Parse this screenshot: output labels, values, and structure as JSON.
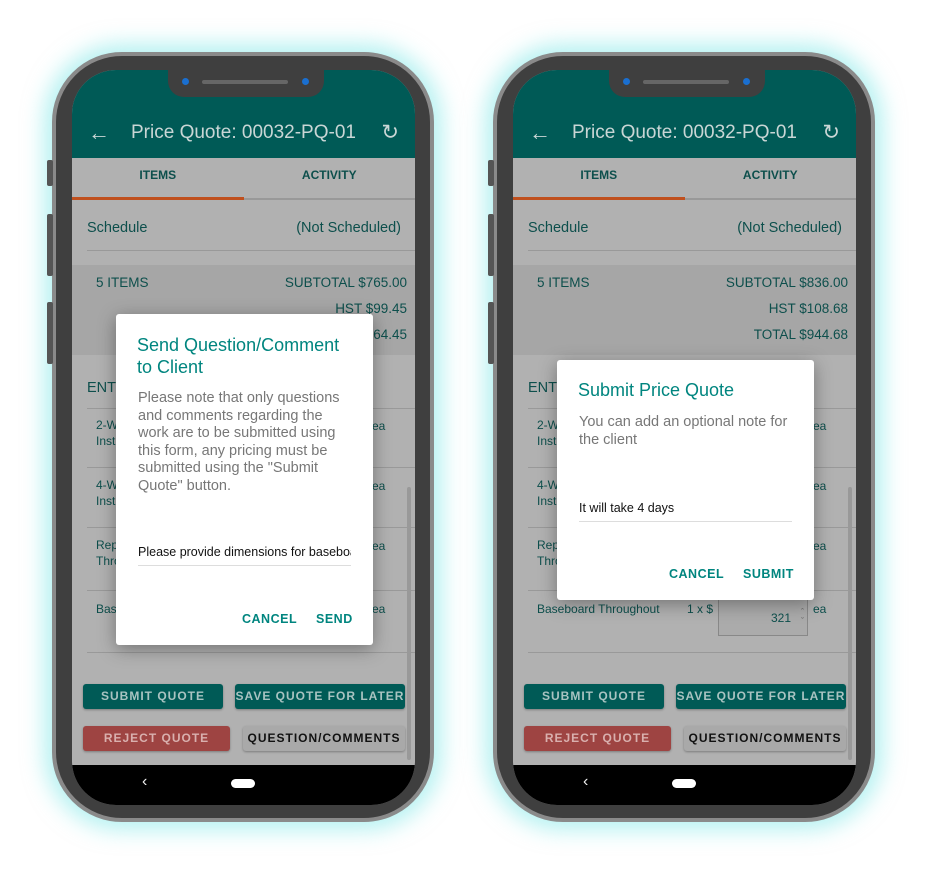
{
  "colors": {
    "header": "#005a56",
    "accent": "#00857f",
    "tab_indicator": "#c0501e",
    "reject": "#9e4442"
  },
  "phones": [
    {
      "header": {
        "back_icon": "arrow-left-icon",
        "title": "Price Quote: 00032-PQ-01",
        "refresh_icon": "refresh-icon"
      },
      "tabs": [
        "ITEMS",
        "ACTIVITY"
      ],
      "schedule": {
        "label": "Schedule",
        "value": "(Not Scheduled)"
      },
      "summary": {
        "count": "5 ITEMS",
        "subtotal": "SUBTOTAL $765.00",
        "hst": "HST $99.45",
        "total": "64.45"
      },
      "section_label": "ENTI",
      "rows": [
        {
          "l1": "2-W",
          "l2": "Inst",
          "unit": "ea"
        },
        {
          "l1": "4-W",
          "l2": "Inst",
          "unit": "ea"
        },
        {
          "l1": "Rep",
          "l2": "Thro",
          "unit": "ea"
        },
        {
          "l1": "Bas",
          "l2": "",
          "unit": "ea"
        }
      ],
      "buttons": {
        "submit": "SUBMIT QUOTE",
        "save": "SAVE QUOTE FOR LATER",
        "reject": "REJECT QUOTE",
        "question": "QUESTION/COMMENTS"
      },
      "dialog": {
        "title": "Send Question/Comment to Client",
        "body": "Please note that only questions and comments regarding the work are to be submitted using this form, any pricing must be submitted using the \"Submit Quote\" button.",
        "input_value": "Please provide dimensions for baseboard",
        "cancel": "CANCEL",
        "confirm": "SEND"
      }
    },
    {
      "header": {
        "back_icon": "arrow-left-icon",
        "title": "Price Quote: 00032-PQ-01",
        "refresh_icon": "refresh-icon"
      },
      "tabs": [
        "ITEMS",
        "ACTIVITY"
      ],
      "schedule": {
        "label": "Schedule",
        "value": "(Not Scheduled)"
      },
      "summary": {
        "count": "5 ITEMS",
        "subtotal": "SUBTOTAL $836.00",
        "hst": "HST $108.68",
        "total": "TOTAL $944.68"
      },
      "section_label": "ENTI",
      "rows": [
        {
          "l1": "2-W",
          "l2": "Inst",
          "unit": "ea"
        },
        {
          "l1": "4-W",
          "l2": "Inst",
          "unit": "ea"
        },
        {
          "l1": "Rep",
          "l2": "Thro",
          "unit": "ea"
        },
        {
          "l1": "Baseboard Throughout",
          "l2": "",
          "qty": "1 x $",
          "price": "321",
          "unit": "ea"
        }
      ],
      "buttons": {
        "submit": "SUBMIT QUOTE",
        "save": "SAVE QUOTE FOR LATER",
        "reject": "REJECT QUOTE",
        "question": "QUESTION/COMMENTS"
      },
      "dialog": {
        "title": "Submit Price Quote",
        "body": "You can add an optional note for the client",
        "input_value": "It will take 4 days",
        "cancel": "CANCEL",
        "confirm": "SUBMIT"
      }
    }
  ]
}
